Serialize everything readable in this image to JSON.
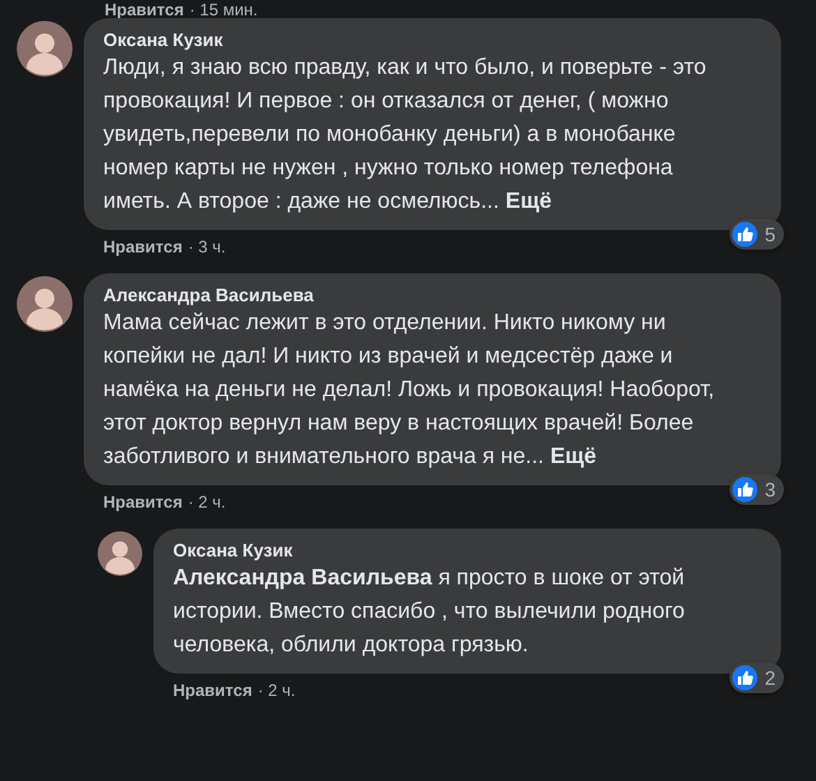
{
  "previous_actions": {
    "like": "Нравится",
    "time": "· 15 мин."
  },
  "comments": [
    {
      "author": "Оксана Кузик",
      "text": "Люди, я знаю всю правду, как и что было, и поверьте - это провокация! И первое : он отказался от денег, ( можно увидеть,перевели по монобанку деньги) а в монобанке номер карты не нужен , нужно только номер телефона иметь. А второе : даже не осмелюсь...",
      "more": "Ещё",
      "reactions": "5",
      "like": "Нравится",
      "time": "· 3 ч."
    },
    {
      "author": "Александра Васильева",
      "text": "Мама сейчас лежит в это отделении. Никто никому ни копейки не дал! И никто из врачей и медсестёр даже и намёка на деньги не делал! Ложь и провокация! Наоборот, этот доктор вернул нам веру в настоящих врачей! Более заботливого и внимательного врача я не...",
      "more": "Ещё",
      "reactions": "3",
      "like": "Нравится",
      "time": "· 2 ч.",
      "replies": [
        {
          "author": "Оксана Кузик",
          "text": "**Александра Васильева** я просто в шоке от этой истории. Вместо спасибо , что вылечили родного человека, облили доктора грязью.",
          "reactions": "2",
          "like": "Нравится",
          "time": "· 2 ч."
        }
      ]
    }
  ]
}
